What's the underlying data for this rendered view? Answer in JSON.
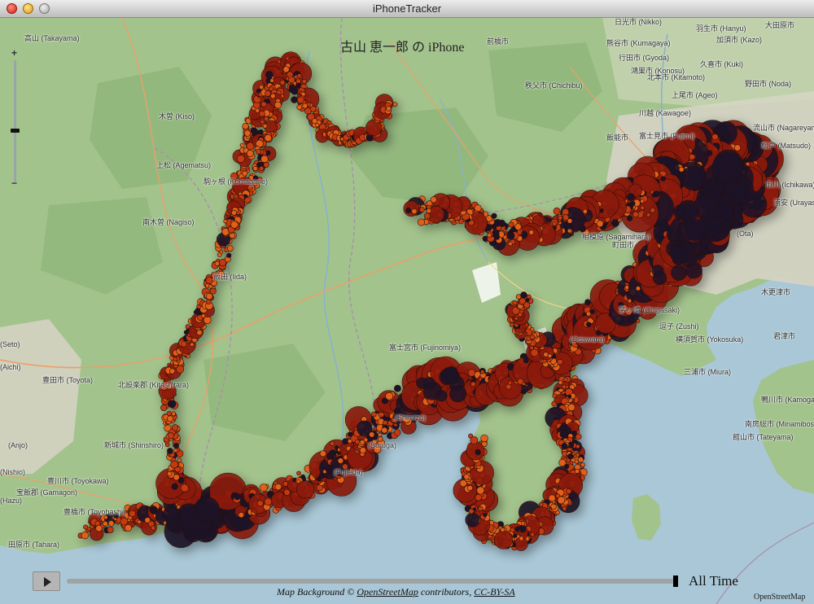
{
  "window": {
    "title": "iPhoneTracker"
  },
  "map": {
    "heading": "古山 恵一郎 の iPhone",
    "places": [
      "高山 (Takayama)",
      "日光市 (Nikko)",
      "前橋市",
      "大田原市",
      "熊谷市 (Kumagaya)",
      "羽生市 (Hanyu)",
      "行田市 (Gyoda)",
      "加須市 (Kazo)",
      "鴻巣市 (Konosu)",
      "久喜市 (Kuki)",
      "秩父市 (Chichibu)",
      "北本市 (Kitamoto)",
      "上尾市 (Ageo)",
      "野田市 (Noda)",
      "川越 (Kawagoe)",
      "飯能市",
      "富士見市 (Fujimi)",
      "流山市 (Nagareyama)",
      "松戸 (Matsudo)",
      "市川 (Ichikawa)",
      "浦安 (Urayasu)",
      "相模原 (Sagamihara)",
      "町田市",
      "茅ヶ崎 (Chigasaki)",
      "逗子 (Zushi)",
      "横須賀市 (Yokosuka)",
      "三浦市 (Miura)",
      "木更津市",
      "君津市",
      "鴨川市 (Kamogawa)",
      "南房総市 (Minamiboso)",
      "館山市 (Tateyama)",
      "富士宮市 (Fujinomiya)",
      "飯田 (Iida)",
      "駒ヶ根 (Komagane)",
      "木曽 (Kiso)",
      "上松 (Agematsu)",
      "南木曽 (Nagiso)",
      "(Seto)",
      "(Aichi)",
      "豊田市 (Toyota)",
      "北設楽郡 (Kitashitara)",
      "新城市 (Shinshiro)",
      "(Anjo)",
      "(Nishio)",
      "豊川市 (Toyokawa)",
      "宝飯郡 (Gamagori)",
      "(Hazu)",
      "豊橋市 (Toyohashi)",
      "田原市 (Tahara)",
      "(Suruga)",
      "(Fujieda)",
      "(Shimizu)",
      "(Odawara)",
      "(Ota)"
    ],
    "zoom": {
      "plus": "+",
      "minus": "−"
    }
  },
  "timeline": {
    "play_icon": "play-icon",
    "label": "All Time",
    "progress": 1.0
  },
  "credits": {
    "prefix": "Map Background © ",
    "osm_link": "OpenStreetMap",
    "middle": " contributors, ",
    "license_link": "CC-BY-SA",
    "corner": "OpenStreetMap"
  },
  "colors": {
    "land": "#a3c38d",
    "water": "#a9c7d6",
    "urban": "#d9d4c9",
    "dot_light": "#e0601a",
    "dot_dark": "#1c1327"
  }
}
